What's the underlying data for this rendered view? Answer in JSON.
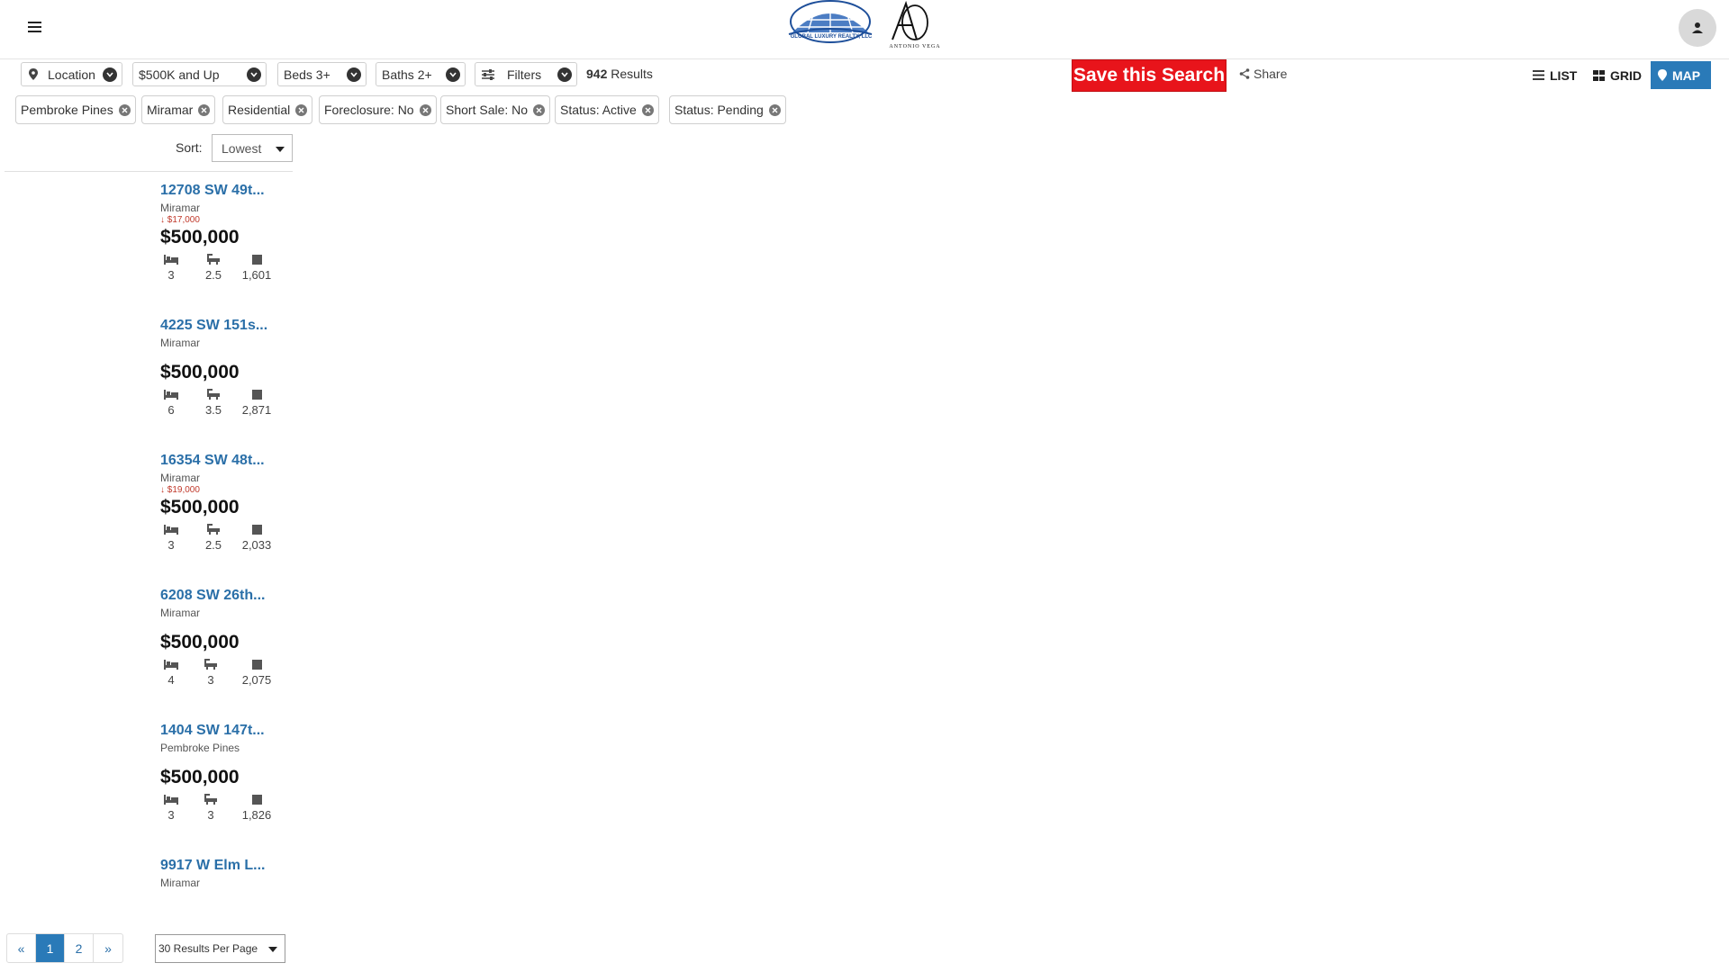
{
  "header": {
    "logo_left_text": "GLOBAL LUXURY REALTY, LLC",
    "logo_right_text": "ANTONIO VEGA"
  },
  "filters": {
    "location": "Location",
    "price": "$500K and Up",
    "beds": "Beds 3+",
    "baths": "Baths 2+",
    "more": "Filters",
    "results_count": "942",
    "results_label": "Results"
  },
  "actions": {
    "save_search": "Save this Search",
    "share": "Share"
  },
  "views": {
    "list": "LIST",
    "grid": "GRID",
    "map": "MAP"
  },
  "chips": [
    {
      "label": "Pembroke Pines"
    },
    {
      "label": "Miramar"
    },
    {
      "label": "Residential"
    },
    {
      "label": "Foreclosure: No"
    },
    {
      "label": "Short Sale: No"
    },
    {
      "label": "Status: Active"
    },
    {
      "label": "Status: Pending"
    }
  ],
  "sort": {
    "label": "Sort:",
    "value": "Lowest"
  },
  "listings": [
    {
      "address": "12708 SW 49t...",
      "city": "Miramar",
      "price_drop": "↓ $17,000",
      "price": "$500,000",
      "beds": "3",
      "baths": "2.5",
      "sqft": "1,601"
    },
    {
      "address": "4225 SW 151s...",
      "city": "Miramar",
      "price_drop": "",
      "price": "$500,000",
      "beds": "6",
      "baths": "3.5",
      "sqft": "2,871"
    },
    {
      "address": "16354 SW 48t...",
      "city": "Miramar",
      "price_drop": "↓ $19,000",
      "price": "$500,000",
      "beds": "3",
      "baths": "2.5",
      "sqft": "2,033"
    },
    {
      "address": "6208 SW 26th...",
      "city": "Miramar",
      "price_drop": "",
      "price": "$500,000",
      "beds": "4",
      "baths": "3",
      "sqft": "2,075"
    },
    {
      "address": "1404 SW 147t...",
      "city": "Pembroke Pines",
      "price_drop": "",
      "price": "$500,000",
      "beds": "3",
      "baths": "3",
      "sqft": "1,826"
    },
    {
      "address": "9917 W Elm L...",
      "city": "Miramar"
    }
  ],
  "pagination": {
    "prev": "«",
    "pages": [
      "1",
      "2"
    ],
    "next": "»",
    "per_page": "30 Results Per Page"
  },
  "colors": {
    "accent_blue": "#2a7ab8",
    "save_red": "#e8141b",
    "link_blue": "#2a6fa8",
    "drop_red": "#c0392b"
  }
}
